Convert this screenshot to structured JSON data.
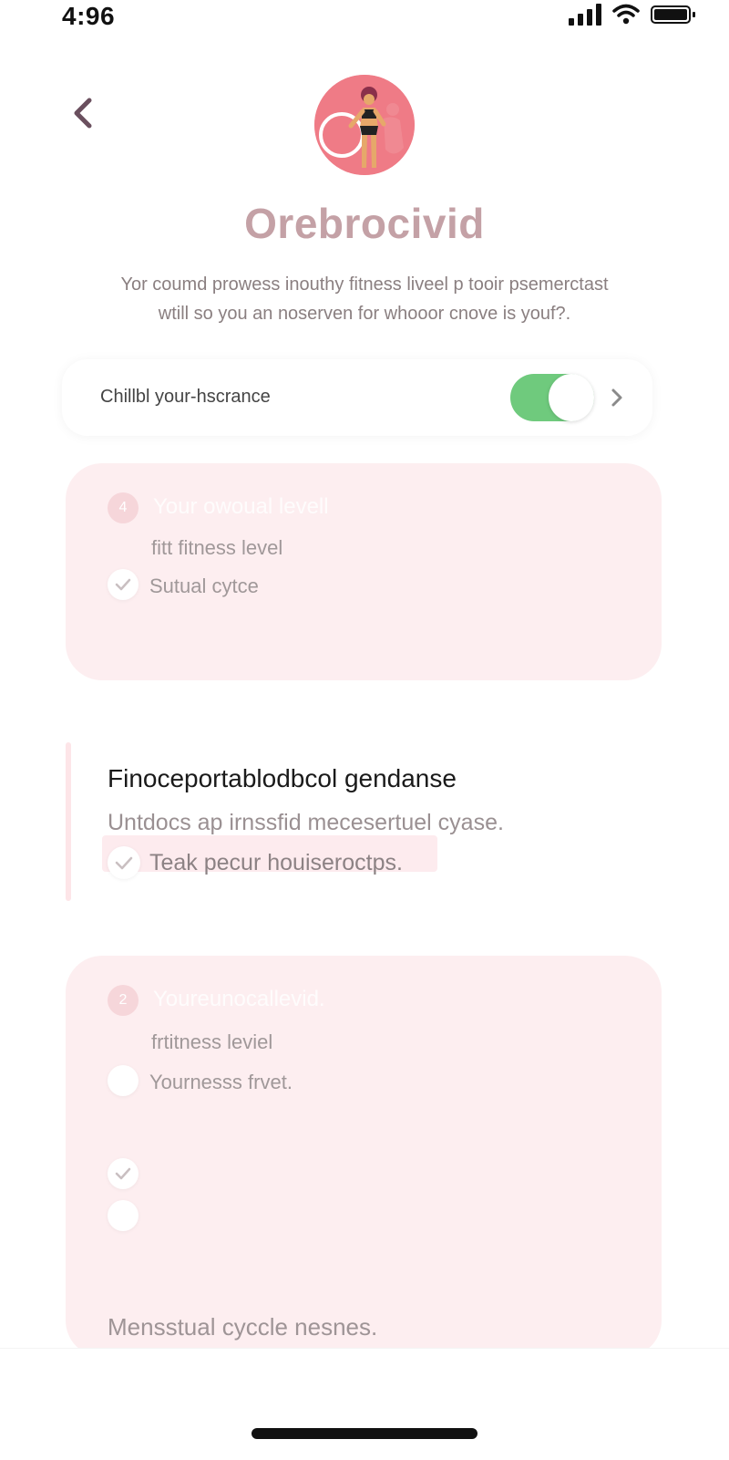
{
  "status_bar": {
    "time": "4:96"
  },
  "header": {
    "title": "Orebrocivid",
    "description_line1": "Yor coumd prowess inouthy fitness liveel p tooir psemerctast",
    "description_line2": "wtill so you an noserven for whooor cnove is youf?."
  },
  "toggle_row": {
    "label": "Chillbl your-hscrance",
    "enabled": true
  },
  "card1": {
    "badge": "4",
    "heading": "Your owoual levell",
    "line": "fitt fitness level",
    "check_label": "Sutual cytce"
  },
  "section": {
    "heading": "Finoceportablodbcol gendanse",
    "subheading": "Untdocs ap irnssfid mecesertuel cyase.",
    "check_label": "Teak pecur houiseroctps."
  },
  "card3": {
    "badge": "2",
    "heading": "Youreunocallevid.",
    "line": "frtitness leviel",
    "option_label": "Yournesss frvet.",
    "footer": "Mensstual cyccle nesnes."
  },
  "colors": {
    "accent_pink": "#ef7b86",
    "card_bg": "#fdeef0",
    "toggle_on": "#6fca7d",
    "title": "#c4a1a6"
  },
  "icons": [
    "back-chevron-icon",
    "signal-icon",
    "wifi-icon",
    "battery-icon",
    "chevron-right-icon",
    "check-icon"
  ]
}
